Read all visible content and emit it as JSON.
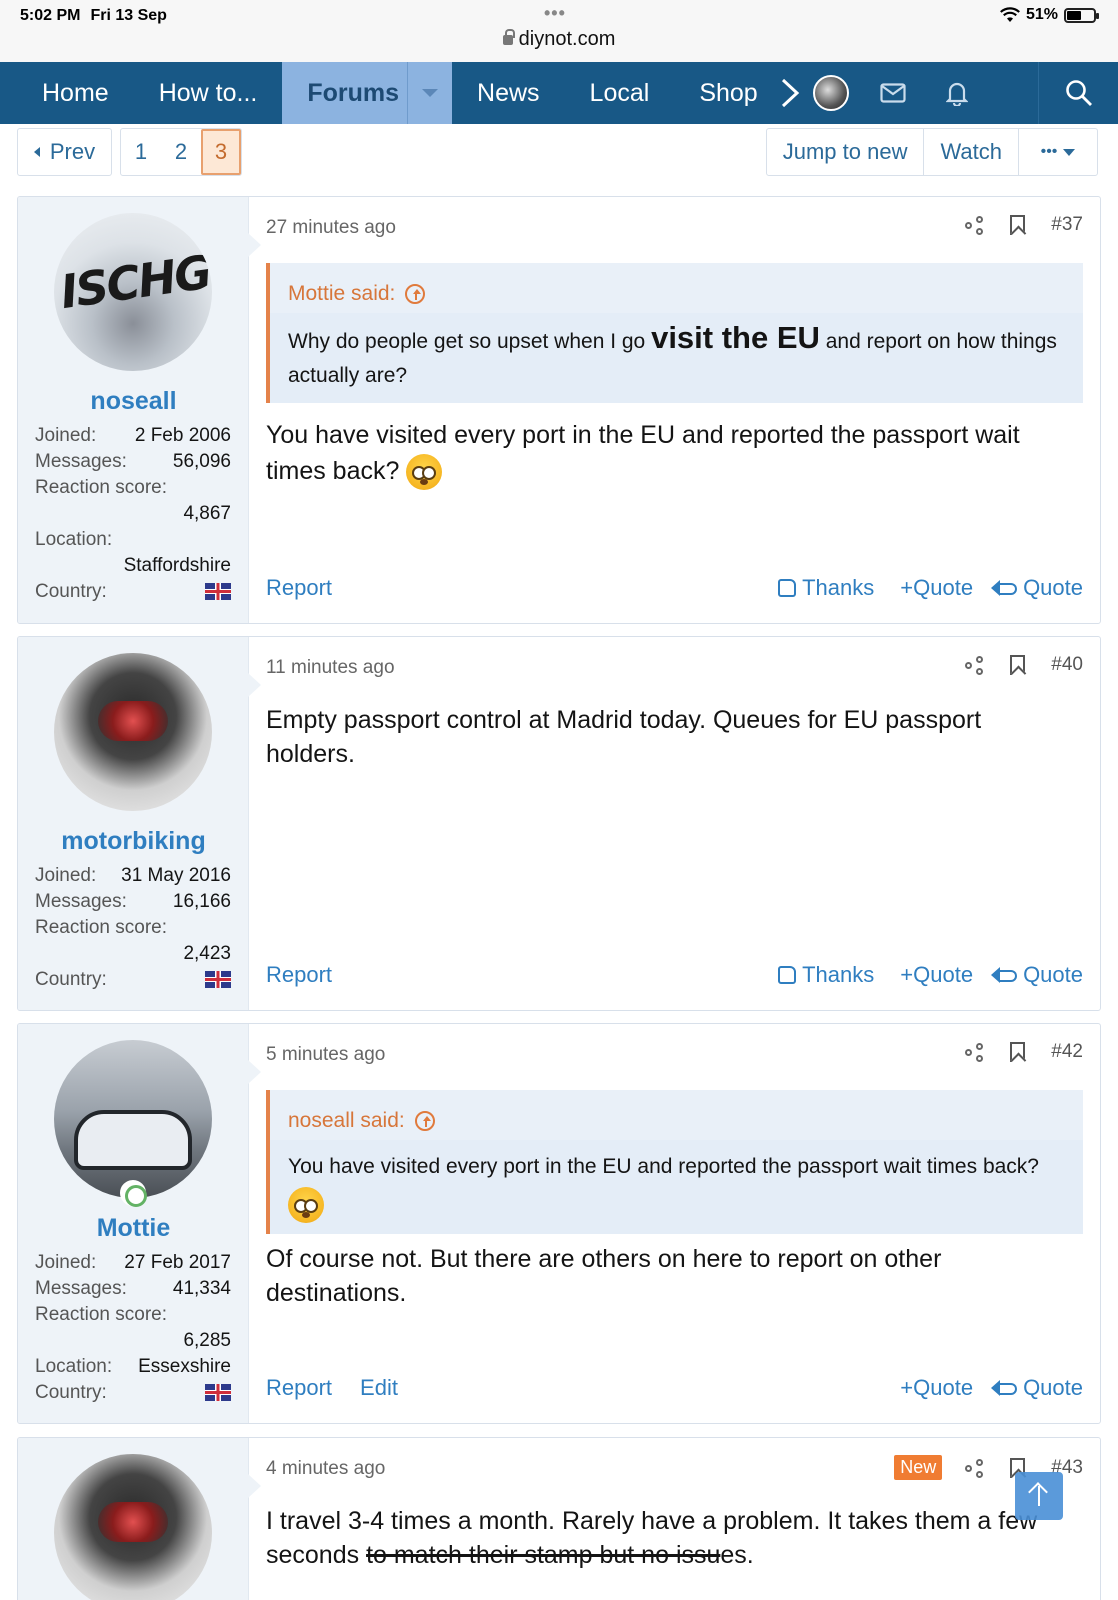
{
  "status_bar": {
    "time": "5:02 PM",
    "date": "Fri 13 Sep",
    "battery": "51%",
    "url": "diynot.com"
  },
  "nav": {
    "items": [
      "Home",
      "How to...",
      "Forums",
      "News",
      "Local",
      "Shop"
    ],
    "active": "Forums"
  },
  "pagination": {
    "prev_label": "Prev",
    "pages": [
      "1",
      "2",
      "3"
    ],
    "current_page": "3",
    "jump_label": "Jump to new",
    "watch_label": "Watch",
    "more_label": "•••"
  },
  "posts": [
    {
      "username": "noseall",
      "joined_label": "Joined:",
      "joined": "2 Feb 2006",
      "messages_label": "Messages:",
      "messages": "56,096",
      "reaction_label": "Reaction score:",
      "reaction": "4,867",
      "location_label": "Location:",
      "location": "Staffordshire",
      "country_label": "Country:",
      "time": "27 minutes ago",
      "number": "#37",
      "quote_author": "Mottie said:",
      "quote_pre": "Why do people get so upset when I go ",
      "quote_emph": "visit the EU",
      "quote_post": " and report on how things actually are?",
      "body": "You have visited every port in the EU and reported the passport wait times back?",
      "actions": {
        "report": "Report",
        "thanks": "Thanks",
        "quote_plus": "Quote",
        "quote": "Quote"
      }
    },
    {
      "username": "motorbiking",
      "joined_label": "Joined:",
      "joined": "31 May 2016",
      "messages_label": "Messages:",
      "messages": "16,166",
      "reaction_label": "Reaction score:",
      "reaction": "2,423",
      "country_label": "Country:",
      "time": "11 minutes ago",
      "number": "#40",
      "body": "Empty passport control at Madrid today. Queues for EU passport holders.",
      "actions": {
        "report": "Report",
        "thanks": "Thanks",
        "quote_plus": "Quote",
        "quote": "Quote"
      }
    },
    {
      "username": "Mottie",
      "joined_label": "Joined:",
      "joined": "27 Feb 2017",
      "messages_label": "Messages:",
      "messages": "41,334",
      "reaction_label": "Reaction score:",
      "reaction": "6,285",
      "location_label": "Location:",
      "location": "Essexshire",
      "country_label": "Country:",
      "time": "5 minutes ago",
      "number": "#42",
      "quote_author": "noseall said:",
      "quote_text": "You have visited every port in the EU and reported the passport wait times back?",
      "body": "Of course not. But there are others on here to report on other destinations.",
      "actions": {
        "report": "Report",
        "edit": "Edit",
        "quote_plus": "Quote",
        "quote": "Quote"
      }
    },
    {
      "time": "4 minutes ago",
      "badge": "New",
      "number": "#43",
      "body_pre": "I travel 3-4 times a month. Rarely have a problem. It takes them a few seconds ",
      "body_strike": "to match their stamp but no issu",
      "body_post": "es."
    }
  ]
}
